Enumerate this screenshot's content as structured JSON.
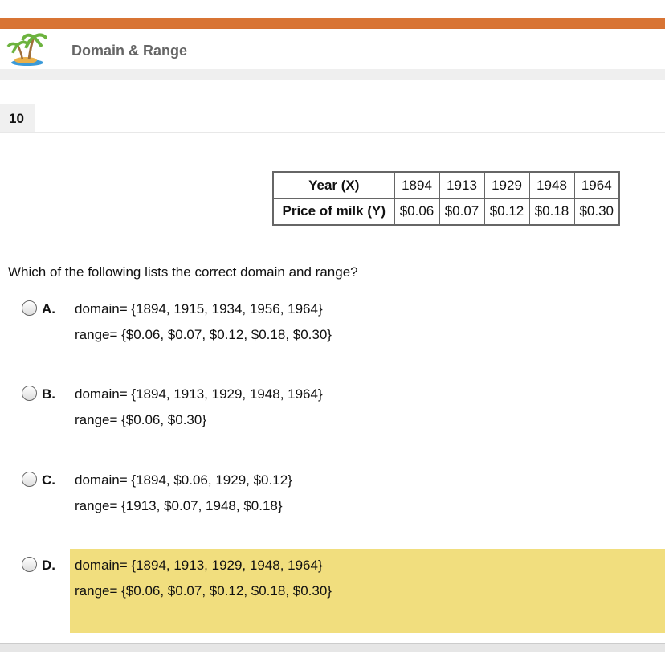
{
  "header": {
    "title": "Domain & Range"
  },
  "question": {
    "number": "10",
    "table": {
      "rows": [
        {
          "label": "Year (X)",
          "values": [
            "1894",
            "1913",
            "1929",
            "1948",
            "1964"
          ]
        },
        {
          "label": "Price of milk (Y)",
          "values": [
            "$0.06",
            "$0.07",
            "$0.12",
            "$0.18",
            "$0.30"
          ]
        }
      ]
    },
    "prompt": "Which of the following lists the correct domain and range?",
    "options": [
      {
        "letter": "A.",
        "domain": "domain= {1894, 1915, 1934, 1956, 1964}",
        "range": "range= {$0.06, $0.07, $0.12, $0.18, $0.30}"
      },
      {
        "letter": "B.",
        "domain": "domain= {1894, 1913, 1929, 1948, 1964}",
        "range": "range= {$0.06, $0.30}"
      },
      {
        "letter": "C.",
        "domain": "domain= {1894, $0.06, 1929, $0.12}",
        "range": "range= {1913, $0.07, 1948, $0.18}"
      },
      {
        "letter": "D.",
        "domain": "domain= {1894, 1913, 1929, 1948, 1964}",
        "range": "range= {$0.06, $0.07, $0.12, $0.18, $0.30}"
      }
    ],
    "highlighted_option": "D."
  },
  "colors": {
    "accent": "#d87434",
    "highlight": "#f1de7e"
  }
}
